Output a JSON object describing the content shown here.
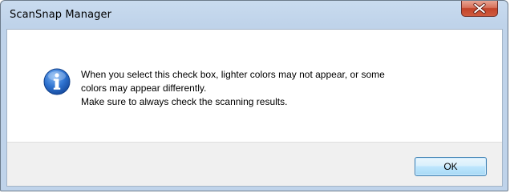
{
  "window": {
    "title": "ScanSnap Manager",
    "close_icon": "close-icon"
  },
  "dialog": {
    "icon": "information-icon",
    "message_lines": [
      "When you select this check box, lighter colors may not appear, or some",
      "colors may appear differently.",
      "Make sure to always check the scanning results."
    ]
  },
  "buttons": {
    "ok_label": "OK"
  },
  "colors": {
    "frame": "#bfd3ea",
    "close_button": "#c2432a",
    "ok_border": "#3c7fb1",
    "info_icon": "#1f5fb6"
  }
}
